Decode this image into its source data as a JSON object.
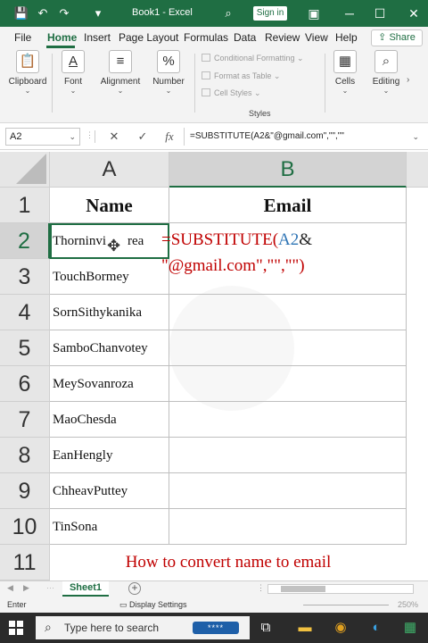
{
  "window": {
    "title": "Book1 - Excel",
    "signin": "Sign in",
    "controls": {
      "minimize": "─",
      "restore": "☐",
      "close": "✕",
      "save": "💾",
      "undo": "↶",
      "redo": "↷",
      "more": "▾",
      "search": "⌕",
      "ribbon_toggle": "▣"
    }
  },
  "menu": {
    "items": [
      "File",
      "Home",
      "Insert",
      "Page Layout",
      "Formulas",
      "Data",
      "Review",
      "View",
      "Help"
    ],
    "active": "Home",
    "share": "Share"
  },
  "ribbon": {
    "clipboard": "Clipboard",
    "font": "Font",
    "alignment": "Alignment",
    "number": "Number",
    "conditional_formatting": "Conditional Formatting",
    "format_as_table": "Format as Table",
    "cell_styles": "Cell Styles",
    "styles": "Styles",
    "cells": "Cells",
    "editing": "Editing",
    "icons": {
      "clipboard": "📋",
      "font": "A",
      "alignment": "≡",
      "number": "%",
      "cells": "▦",
      "editing": "⌕"
    }
  },
  "formula_bar": {
    "name_box": "A2",
    "cancel": "✕",
    "enter": "✓",
    "fx": "fx",
    "formula": "=SUBSTITUTE(A2&\"@gmail.com\",\"\",\"\""
  },
  "grid": {
    "columns": [
      "A",
      "B"
    ],
    "rows": [
      "1",
      "2",
      "3",
      "4",
      "5",
      "6",
      "7",
      "8",
      "9",
      "10",
      "11"
    ],
    "header": {
      "name": "Name",
      "email": "Email"
    },
    "names": [
      "Thorninvi",
      "TouchBormey",
      "SornSithykanika",
      "SamboChanvotey",
      "MeySovanroza",
      "MaoChesda",
      "EanHengly",
      "ChheavPuttey",
      "TinSona"
    ],
    "name_row2_tail": "rea",
    "editing_formula": {
      "line1_a": "=SUBSTITUTE(",
      "line1_ref": "A2",
      "line1_b": "&",
      "line2": "\"@gmail.com\",\"\",\"\")"
    },
    "note": "How to convert name to email"
  },
  "sheets": {
    "tabs": [
      "Sheet1"
    ],
    "add": "+"
  },
  "status": {
    "mode": "Enter",
    "display_settings": "Display Settings",
    "zoom": "250%"
  },
  "taskbar": {
    "search_placeholder": "Type here to search",
    "password_dots": "****"
  }
}
